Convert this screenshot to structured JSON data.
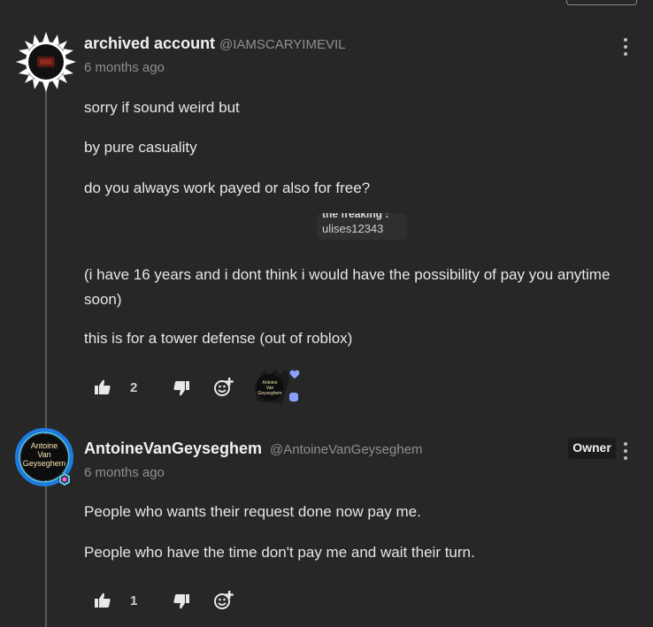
{
  "comments": [
    {
      "author": "archived account",
      "handle": "@IAMSCARYIMEVIL",
      "time": "6 months ago",
      "paragraphs": [
        "sorry if sound weird but",
        "by pure casuality",
        "do you always work payed or also for free?",
        "(i have 16 years and i dont think i would have the possibility of pay you anytime soon)",
        "this is for a tower defense (out of roblox)"
      ],
      "embed": {
        "cut_text": "the freaking :",
        "username": "ulises12343"
      },
      "likes": "2",
      "heart_avatar_text": "Antoine Van Geyseghem"
    },
    {
      "author": "AntoineVanGeyseghem",
      "handle": "@AntoineVanGeyseghem",
      "time": "6 months ago",
      "badge": "Owner",
      "avatar_text": "Antoine Van Geyseghem",
      "paragraphs": [
        "People who wants their request done now pay me.",
        "People who have the time don't pay me and wait their turn."
      ],
      "likes": "1"
    }
  ],
  "icons": [
    "thumbs-up-icon",
    "thumbs-down-icon",
    "add-emoji-icon",
    "more-vertical-icon",
    "heart-icon"
  ],
  "colors": {
    "background": "#272727",
    "owner_badge": "#1c1c1c",
    "ring_blue": "#1e7be0",
    "heart": "#8aa0ff"
  }
}
